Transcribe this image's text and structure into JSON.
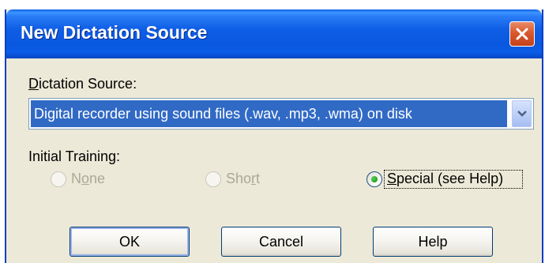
{
  "window": {
    "title": "New Dictation Source"
  },
  "dictation_source": {
    "label": "Dictation Source:",
    "label_mnemonic": "D",
    "label_rest": "ictation Source:",
    "selected_value": "Digital recorder using sound files (.wav, .mp3, .wma) on disk"
  },
  "initial_training": {
    "label": "Initial Training:",
    "options": [
      {
        "label": "None",
        "mnemonic_prefix": "N",
        "mnemonic": "o",
        "mnemonic_suffix": "ne",
        "enabled": false,
        "selected": false
      },
      {
        "label": "Short",
        "mnemonic_prefix": "Sho",
        "mnemonic": "r",
        "mnemonic_suffix": "t",
        "enabled": false,
        "selected": false
      },
      {
        "label": "Special (see Help)",
        "mnemonic_prefix": "",
        "mnemonic": "S",
        "mnemonic_suffix": "pecial (see Help)",
        "enabled": true,
        "selected": true
      }
    ]
  },
  "buttons": {
    "ok": "OK",
    "cancel": "Cancel",
    "help": "Help"
  },
  "colors": {
    "titlebar": "#0a58df",
    "dialog_bg": "#ece9d8",
    "selection": "#316ac5",
    "close_button": "#d9592d",
    "disabled_text": "#aca899"
  }
}
